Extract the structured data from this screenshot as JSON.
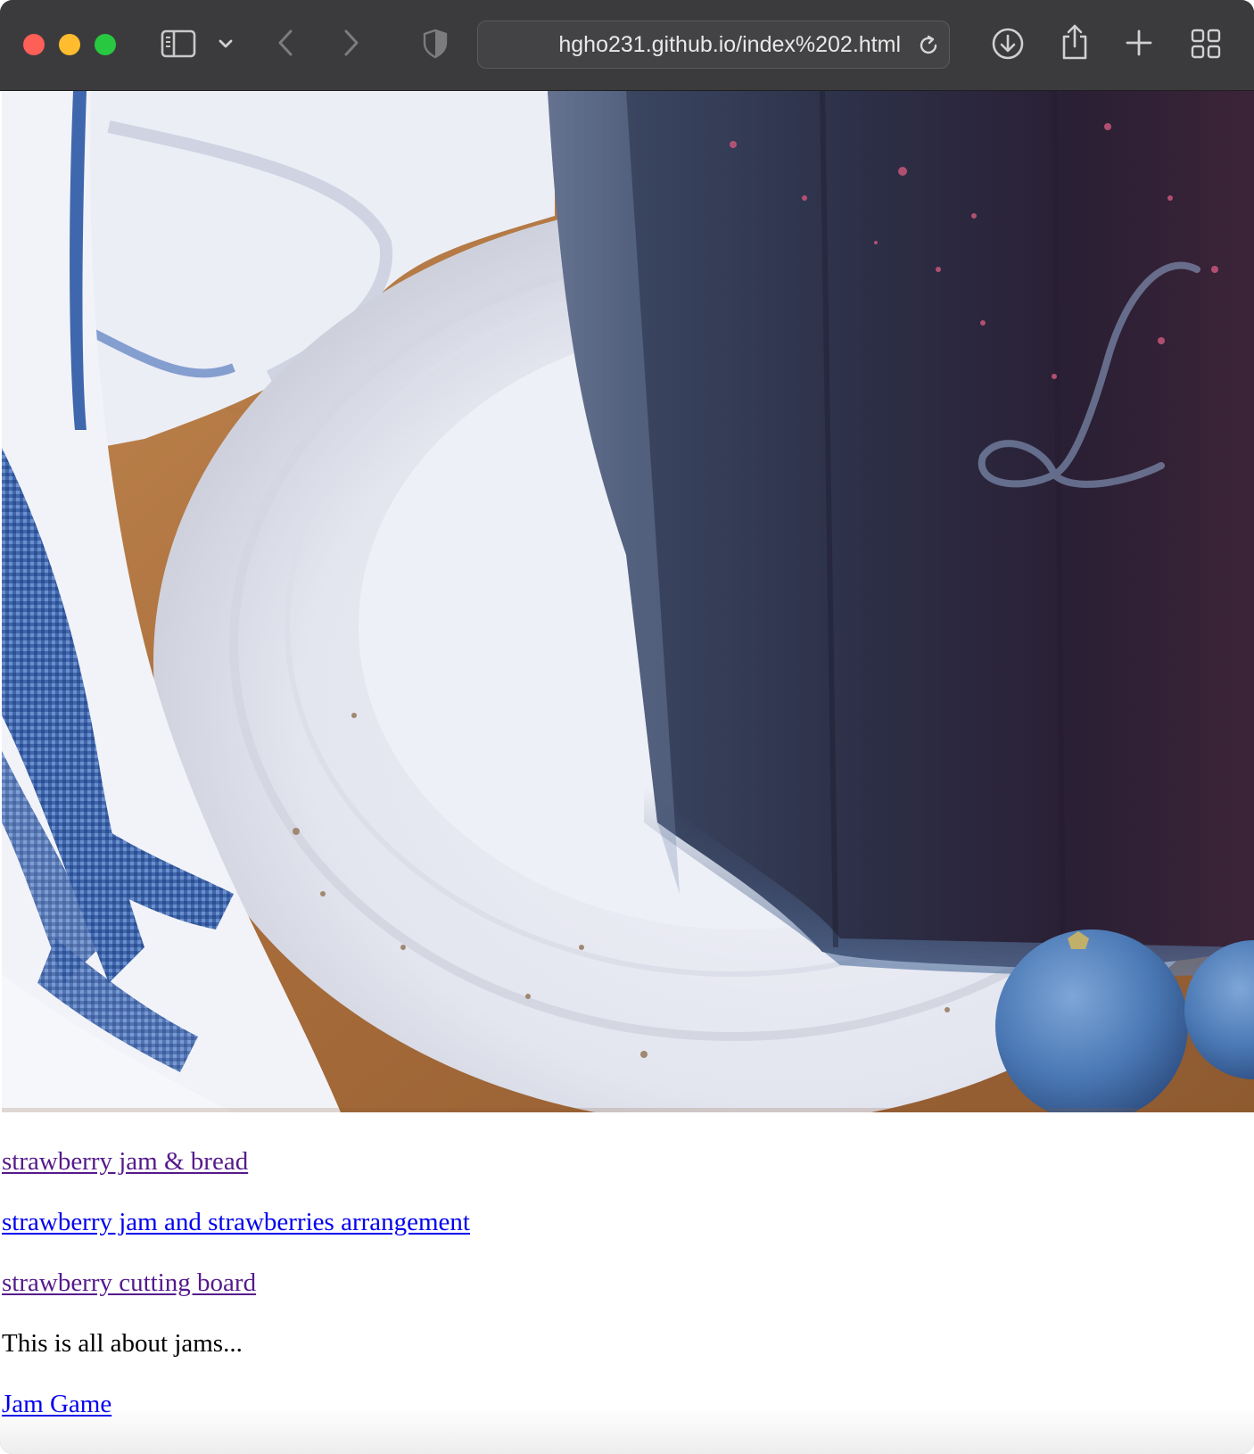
{
  "browser": {
    "url": "hgho231.github.io/index%202.html",
    "buttons": {
      "close": "close-window",
      "minimize": "minimize-window",
      "zoom": "zoom-window",
      "sidebar": "sidebar-icon",
      "tab_menu": "chevron-down-icon",
      "back": "back-icon",
      "forward": "forward-icon",
      "privacy": "shield-icon",
      "reload": "reload-icon",
      "downloads": "download-icon",
      "share": "share-icon",
      "new_tab": "plus-icon",
      "tab_overview": "grid-icon"
    }
  },
  "page": {
    "hero_image": {
      "subject": "blueberry jam jar on white plate with blue striped towel and blueberries"
    },
    "links": [
      {
        "label": "strawberry jam & bread",
        "state": "visited"
      },
      {
        "label": "strawberry jam and strawberries arrangement",
        "state": "unvisited"
      },
      {
        "label": "strawberry cutting board",
        "state": "visited"
      }
    ],
    "paragraph": "This is all about jams...",
    "game_link": {
      "label": "Jam Game",
      "state": "unvisited"
    }
  },
  "colors": {
    "visited_link": "#551a8b",
    "unvisited_link": "#0000ee",
    "toolbar": "#3b3b3d"
  }
}
